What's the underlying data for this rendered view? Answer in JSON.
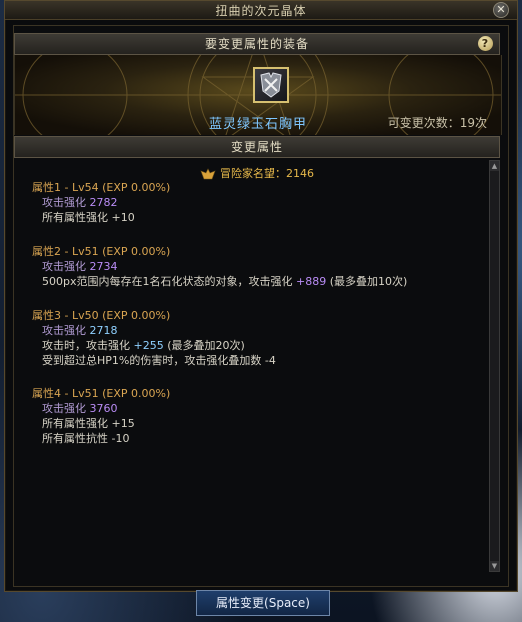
{
  "window": {
    "title": "扭曲的次元晶体",
    "close_label": "✕"
  },
  "section_equipment": {
    "label": "要变更属性的装备",
    "help_label": "?"
  },
  "equipment": {
    "name": "蓝灵绿玉石胸甲",
    "change_count": "可变更次数：19次"
  },
  "section_change": {
    "label": "变更属性"
  },
  "fame": {
    "label": "冒险家名望：2146"
  },
  "attributes": [
    {
      "head": "属性1 - Lv54 (EXP 0.00%)",
      "sub_label": "攻击强化",
      "sub_value": "2782",
      "lines": [
        {
          "text": "所有属性强化 +10"
        }
      ]
    },
    {
      "head": "属性2 - Lv51 (EXP 0.00%)",
      "sub_label": "攻击强化",
      "sub_value": "2734",
      "line_a": "500px范围内每存在1名石化状态的对象，攻击强化",
      "line_a_value": "+889",
      "line_a_tail": "(最多叠加10次)"
    },
    {
      "head": "属性3 - Lv50 (EXP 0.00%)",
      "sub_label": "攻击强化",
      "sub_value": "2718",
      "line_a": "攻击时，攻击强化",
      "line_a_value": "+255",
      "line_a_tail": "(最多叠加20次)",
      "line_b": "受到超过总HP1%的伤害时，攻击强化叠加数 -4"
    },
    {
      "head": "属性4 - Lv51 (EXP 0.00%)",
      "sub_label": "攻击强化",
      "sub_value": "3760",
      "line_a": "所有属性强化 +15",
      "line_b": "所有属性抗性 -10"
    }
  ],
  "footer": {
    "button_label": "属性变更(Space)"
  },
  "colors": {
    "attr_head": "#d9a552",
    "sub_label": "#b19bd3",
    "value_purple": "#b98cf5",
    "value_blue": "#8fd0ff",
    "equip_name": "#7fc7ff",
    "fame": "#e6b84a"
  },
  "icons": {
    "close": "close-icon",
    "help": "help-icon",
    "fame": "fame-crest-icon",
    "equipment": "chest-armor-icon"
  }
}
